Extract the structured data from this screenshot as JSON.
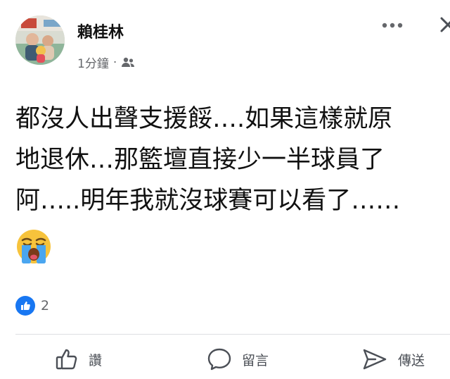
{
  "post": {
    "author": "賴桂林",
    "time": "1分鐘",
    "separator": "·",
    "audience_icon": "friends-icon",
    "lines": [
      "都沒人出聲支援餒….如果這樣就原",
      "地退休…那籃壇直接少一半球員了",
      "阿…..明年我就沒球賽可以看了……"
    ],
    "emoji": "loudly-crying-face-emoji"
  },
  "reactions": {
    "icon": "like-icon",
    "count": "2"
  },
  "actions": [
    {
      "label": "讚",
      "icon": "thumbs-up-icon"
    },
    {
      "label": "留言",
      "icon": "comment-icon"
    },
    {
      "label": "傳送",
      "icon": "send-icon"
    }
  ],
  "colors": {
    "like_blue": "#1877f2",
    "secondary_text": "#65676b",
    "divider": "#dddfe2"
  }
}
